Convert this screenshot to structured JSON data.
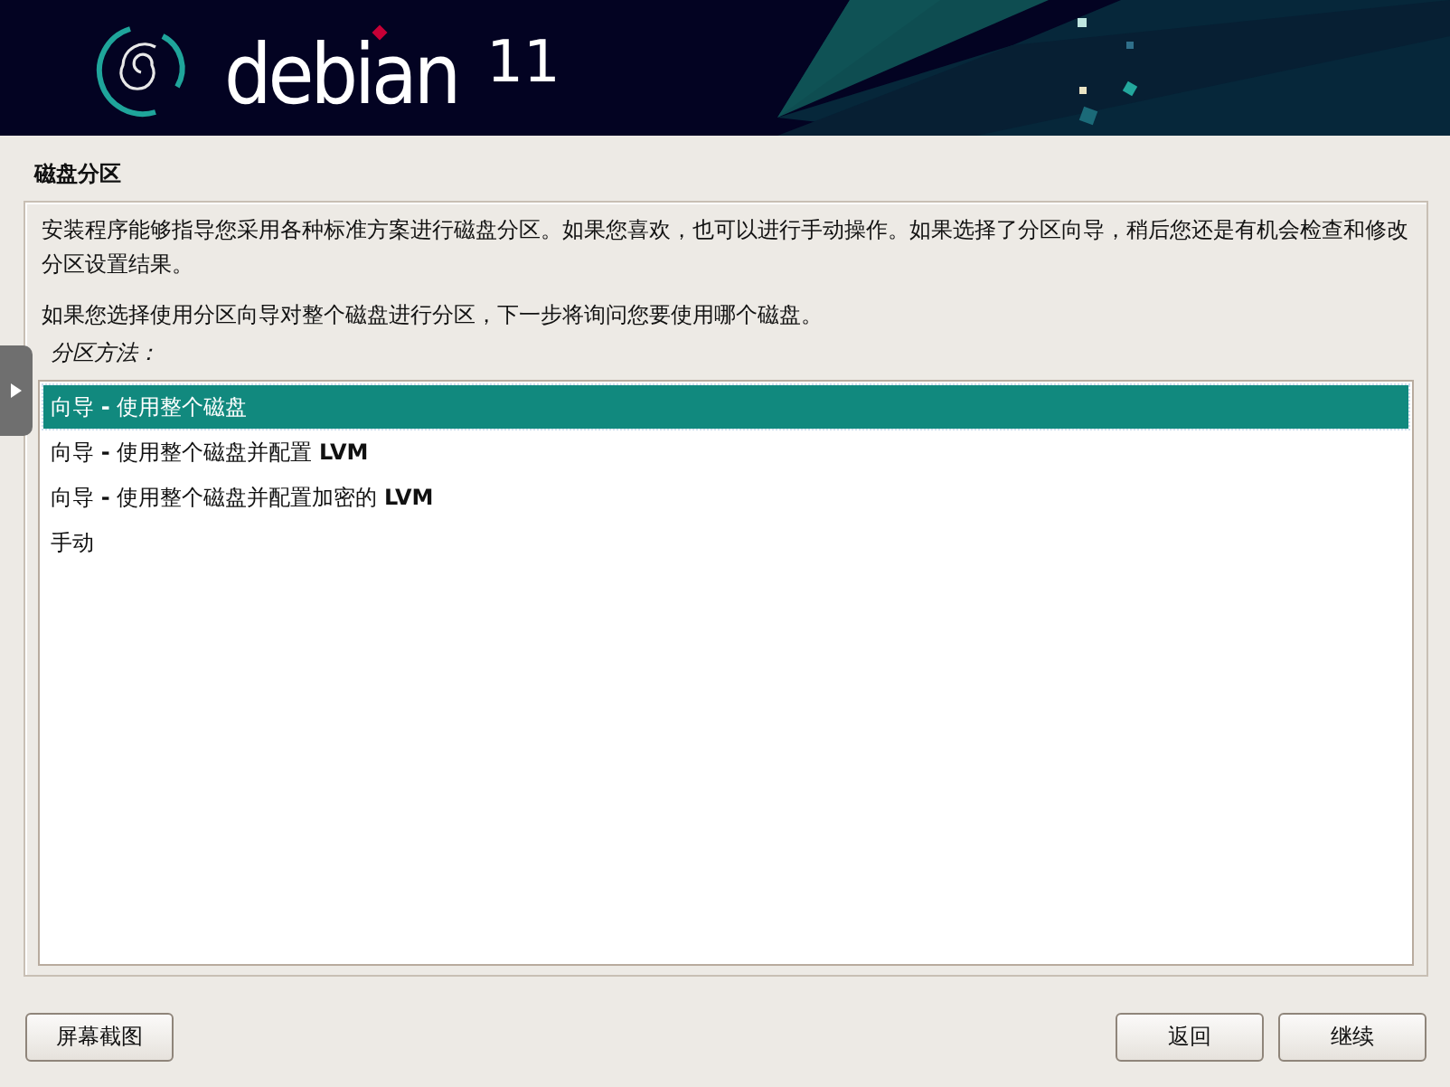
{
  "header": {
    "logo_text": "debian",
    "version": "11"
  },
  "title": "磁盘分区",
  "description": [
    "安装程序能够指导您采用各种标准方案进行磁盘分区。如果您喜欢，也可以进行手动操作。如果选择了分区向导，稍后您还是有机会检查和修改分区设置结果。",
    "如果您选择使用分区向导对整个磁盘进行分区，下一步将询问您要使用哪个磁盘。"
  ],
  "list_label": "分区方法：",
  "options": [
    {
      "label": "向导 **-** 使用整个磁盘",
      "selected": true
    },
    {
      "label": "向导 **-** 使用整个磁盘并配置 **LVM**",
      "selected": false
    },
    {
      "label": "向导 **-** 使用整个磁盘并配置加密的 **LVM**",
      "selected": false
    },
    {
      "label": "手动",
      "selected": false
    }
  ],
  "buttons": [
    {
      "label": "屏幕截图",
      "kind": "left"
    },
    {
      "label": "返回",
      "kind": "right"
    },
    {
      "label": "继续",
      "kind": "right"
    }
  ]
}
